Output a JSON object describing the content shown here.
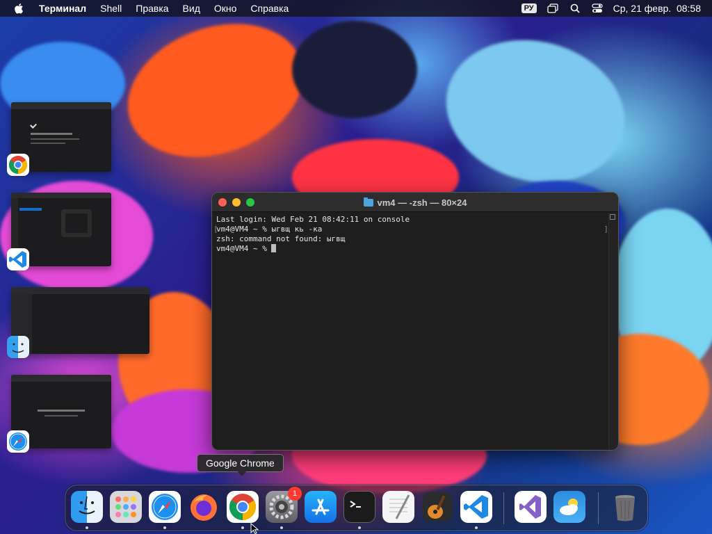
{
  "menubar": {
    "app_name": "Терминал",
    "items": [
      "Shell",
      "Правка",
      "Вид",
      "Окно",
      "Справка"
    ],
    "input_source": "РУ",
    "datetime": "Ср, 21 февр.  08:58"
  },
  "terminal": {
    "title": "vm4 — -zsh — 80×24",
    "lines": [
      "Last login: Wed Feb 21 08:42:11 on console",
      "vm4@VM4 ~ % ыгвщ кь -ка",
      "zsh: command not found: ыгвщ",
      "vm4@VM4 ~ % "
    ]
  },
  "stage_manager": {
    "groups": [
      {
        "app_icon": "chrome-icon"
      },
      {
        "app_icon": "vscode-icon"
      },
      {
        "app_icon": "finder-icon"
      },
      {
        "app_icon": "safari-icon"
      }
    ]
  },
  "tooltip": {
    "text": "Google Chrome"
  },
  "dock": {
    "items": [
      {
        "name": "finder-icon",
        "running": true
      },
      {
        "name": "launchpad-icon",
        "running": false
      },
      {
        "name": "safari-icon",
        "running": true
      },
      {
        "name": "firefox-icon",
        "running": false
      },
      {
        "name": "chrome-icon",
        "running": true
      },
      {
        "name": "system-settings-icon",
        "running": true,
        "badge": "1"
      },
      {
        "name": "app-store-icon",
        "running": false
      },
      {
        "name": "terminal-icon",
        "running": true
      },
      {
        "name": "textedit-icon",
        "running": false
      },
      {
        "name": "garageband-icon",
        "running": false
      },
      {
        "name": "vscode-icon",
        "running": true
      },
      {
        "name": "visual-studio-icon",
        "running": false
      },
      {
        "name": "weather-icon",
        "running": false
      },
      {
        "name": "trash-icon",
        "running": false
      }
    ]
  },
  "colors": {
    "traffic_close": "#ff5f57",
    "traffic_min": "#febc2e",
    "traffic_max": "#28c840",
    "terminal_bg": "#1e1e1e"
  }
}
